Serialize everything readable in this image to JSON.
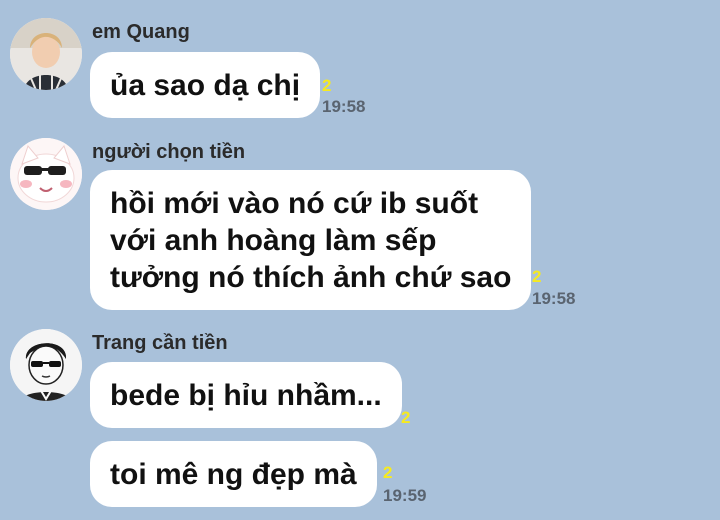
{
  "messages": [
    {
      "sender": "em Quang",
      "avatar_icon": "avatar-photo-young-man",
      "bubbles": [
        {
          "lines": [
            "ủa sao dạ chị"
          ],
          "unread": "2",
          "time": "19:58"
        }
      ]
    },
    {
      "sender": "người chọn tiền",
      "avatar_icon": "avatar-cat-sunglasses",
      "bubbles": [
        {
          "lines": [
            "hồi mới vào nó cứ ib suốt",
            "với anh hoàng làm sếp",
            "tưởng nó thích ảnh chứ sao"
          ],
          "unread": "2",
          "time": "19:58"
        }
      ]
    },
    {
      "sender": "Trang cần tiền",
      "avatar_icon": "avatar-manga-sunglasses",
      "bubbles": [
        {
          "lines": [
            "bede bị hỉu nhầm..."
          ],
          "unread": "2"
        },
        {
          "lines": [
            "toi mê ng đẹp mà"
          ],
          "unread": "2",
          "time": "19:59"
        }
      ]
    }
  ]
}
